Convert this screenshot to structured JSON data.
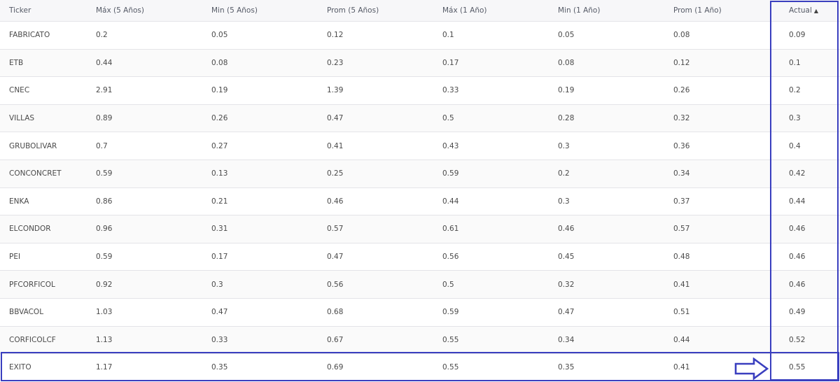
{
  "header": {
    "columns": [
      "Ticker",
      "Máx (5 Años)",
      "Min (5 Años)",
      "Prom (5 Años)",
      "Máx (1 Año)",
      "Min (1 Año)",
      "Prom (1 Año)",
      "Actual"
    ],
    "sort_indicator": "▲"
  },
  "rows": [
    [
      "FABRICATO",
      "0.2",
      "0.05",
      "0.12",
      "0.1",
      "0.05",
      "0.08",
      "0.09"
    ],
    [
      "ETB",
      "0.44",
      "0.08",
      "0.23",
      "0.17",
      "0.08",
      "0.12",
      "0.1"
    ],
    [
      "CNEC",
      "2.91",
      "0.19",
      "1.39",
      "0.33",
      "0.19",
      "0.26",
      "0.2"
    ],
    [
      "VILLAS",
      "0.89",
      "0.26",
      "0.47",
      "0.5",
      "0.28",
      "0.32",
      "0.3"
    ],
    [
      "GRUBOLIVAR",
      "0.7",
      "0.27",
      "0.41",
      "0.43",
      "0.3",
      "0.36",
      "0.4"
    ],
    [
      "CONCONCRET",
      "0.59",
      "0.13",
      "0.25",
      "0.59",
      "0.2",
      "0.34",
      "0.42"
    ],
    [
      "ENKA",
      "0.86",
      "0.21",
      "0.46",
      "0.44",
      "0.3",
      "0.37",
      "0.44"
    ],
    [
      "ELCONDOR",
      "0.96",
      "0.31",
      "0.57",
      "0.61",
      "0.46",
      "0.57",
      "0.46"
    ],
    [
      "PEI",
      "0.59",
      "0.17",
      "0.47",
      "0.56",
      "0.45",
      "0.48",
      "0.46"
    ],
    [
      "PFCORFICOL",
      "0.92",
      "0.3",
      "0.56",
      "0.5",
      "0.32",
      "0.41",
      "0.46"
    ],
    [
      "BBVACOL",
      "1.03",
      "0.47",
      "0.68",
      "0.59",
      "0.47",
      "0.51",
      "0.49"
    ],
    [
      "CORFICOLCF",
      "1.13",
      "0.33",
      "0.67",
      "0.55",
      "0.34",
      "0.44",
      "0.52"
    ],
    [
      "EXITO",
      "1.17",
      "0.35",
      "0.69",
      "0.55",
      "0.35",
      "0.41",
      "0.55"
    ]
  ],
  "colors": {
    "highlight": "#3a3fbf",
    "header_bg": "#f7f7f9",
    "row_alt_bg": "#fafafa",
    "border": "#e4e4e8"
  },
  "icons": {
    "sort": "sort-ascending-icon",
    "annotation": "arrow-right-icon"
  }
}
